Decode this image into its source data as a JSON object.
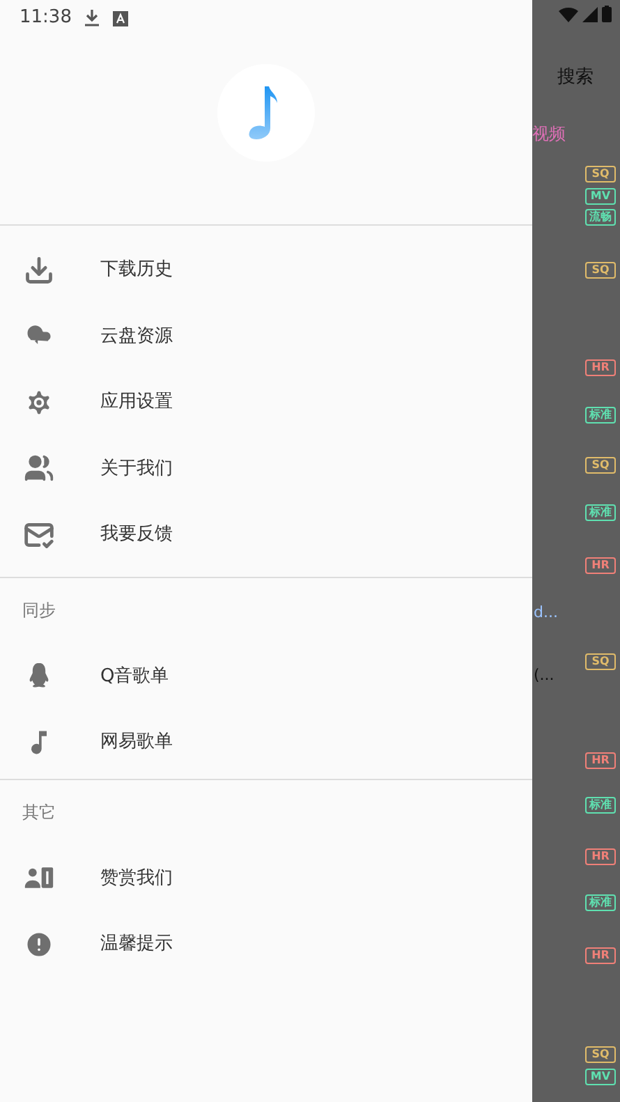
{
  "status_bar": {
    "time": "11:38"
  },
  "drawer": {
    "sections": [
      {
        "items": [
          {
            "label": "下载历史"
          },
          {
            "label": "云盘资源"
          },
          {
            "label": "应用设置"
          },
          {
            "label": "关于我们"
          },
          {
            "label": "我要反馈"
          }
        ]
      },
      {
        "title": "同步",
        "items": [
          {
            "label": "Q音歌单"
          },
          {
            "label": "网易歌单"
          }
        ]
      },
      {
        "title": "其它",
        "items": [
          {
            "label": "赞赏我们"
          },
          {
            "label": "温馨提示"
          }
        ]
      }
    ]
  },
  "background": {
    "search_button": "搜索",
    "tab": "视频",
    "entries": [
      {
        "kind": "badge",
        "label": "SQ",
        "color": "#e0bb6a"
      },
      {
        "kind": "badge",
        "label": "MV",
        "color": "#5fe0b0"
      },
      {
        "kind": "badge",
        "label": "流畅",
        "color": "#5fe0b0"
      },
      {
        "kind": "badge",
        "label": "SQ",
        "color": "#e0bb6a"
      },
      {
        "kind": "badge",
        "label": "HR",
        "color": "#f08078"
      },
      {
        "kind": "badge",
        "label": "标准",
        "color": "#5fe0b0"
      },
      {
        "kind": "badge",
        "label": "SQ",
        "color": "#e0bb6a"
      },
      {
        "kind": "badge",
        "label": "标准",
        "color": "#5fe0b0"
      },
      {
        "kind": "badge",
        "label": "HR",
        "color": "#f08078"
      },
      {
        "kind": "text",
        "label": "d...",
        "color": "#9cc4ff"
      },
      {
        "kind": "badge",
        "label": "SQ",
        "color": "#e0bb6a"
      },
      {
        "kind": "text",
        "label": "(...",
        "color": "#111111"
      },
      {
        "kind": "badge",
        "label": "HR",
        "color": "#f08078"
      },
      {
        "kind": "badge",
        "label": "标准",
        "color": "#5fe0b0"
      },
      {
        "kind": "badge",
        "label": "HR",
        "color": "#f08078"
      },
      {
        "kind": "badge",
        "label": "标准",
        "color": "#5fe0b0"
      },
      {
        "kind": "badge",
        "label": "HR",
        "color": "#f08078"
      },
      {
        "kind": "badge",
        "label": "SQ",
        "color": "#e0bb6a"
      },
      {
        "kind": "badge",
        "label": "MV",
        "color": "#5fe0b0"
      }
    ]
  }
}
